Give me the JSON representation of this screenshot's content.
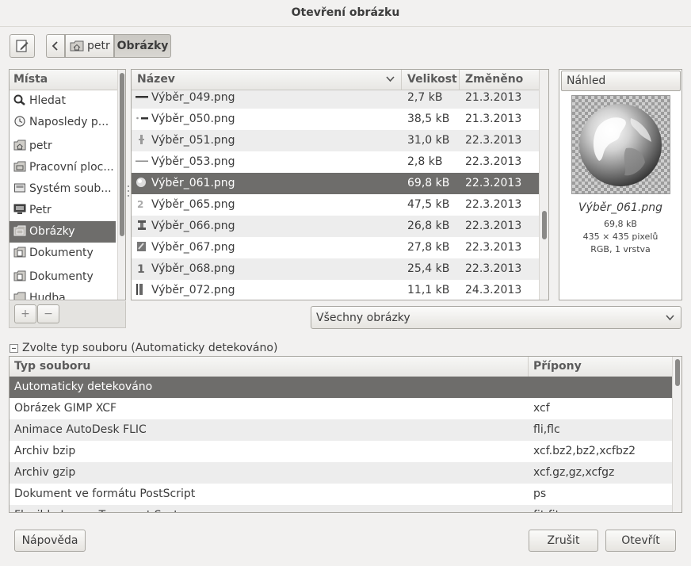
{
  "window": {
    "title": "Otevření obrázku"
  },
  "toolbar": {
    "edit_icon": "pencil-icon",
    "back_icon": "chevron-left-icon",
    "path": [
      {
        "label": "petr",
        "icon": "home-folder-icon"
      },
      {
        "label": "Obrázky"
      }
    ]
  },
  "places": {
    "header": "Místa",
    "items": [
      {
        "label": "Hledat",
        "icon": "search-icon"
      },
      {
        "label": "Naposledy p...",
        "icon": "clock-icon"
      },
      {
        "label": "petr",
        "icon": "home-folder-icon"
      },
      {
        "label": "Pracovní ploc...",
        "icon": "folder-icon"
      },
      {
        "label": "Systém soub...",
        "icon": "drive-icon"
      },
      {
        "label": "Petr",
        "icon": "computer-icon"
      },
      {
        "label": "Obrázky",
        "icon": "folder-icon",
        "selected": true
      },
      {
        "label": "Dokumenty",
        "icon": "folder-icon"
      },
      {
        "label": "Dokumenty",
        "icon": "folder-icon"
      },
      {
        "label": "Hudba",
        "icon": "folder-icon"
      }
    ],
    "add_label": "+",
    "remove_label": "−"
  },
  "files": {
    "columns": {
      "name": "Název",
      "size": "Velikost",
      "modified": "Změněno"
    },
    "rows": [
      {
        "name": "Výběr_049.png",
        "size": "2,7 kB",
        "modified": "21.3.2013"
      },
      {
        "name": "Výběr_050.png",
        "size": "38,5 kB",
        "modified": "21.3.2013"
      },
      {
        "name": "Výběr_051.png",
        "size": "31,0 kB",
        "modified": "22.3.2013"
      },
      {
        "name": "Výběr_053.png",
        "size": "2,8 kB",
        "modified": "22.3.2013"
      },
      {
        "name": "Výběr_061.png",
        "size": "69,8 kB",
        "modified": "22.3.2013",
        "selected": true
      },
      {
        "name": "Výběr_065.png",
        "size": "47,5 kB",
        "modified": "22.3.2013"
      },
      {
        "name": "Výběr_066.png",
        "size": "26,8 kB",
        "modified": "22.3.2013"
      },
      {
        "name": "Výběr_067.png",
        "size": "27,8 kB",
        "modified": "22.3.2013"
      },
      {
        "name": "Výběr_068.png",
        "size": "25,4 kB",
        "modified": "22.3.2013"
      },
      {
        "name": "Výběr_072.png",
        "size": "11,1 kB",
        "modified": "24.3.2013"
      }
    ]
  },
  "preview": {
    "header": "Náhled",
    "filename": "Výběr_061.png",
    "size": "69,8 kB",
    "dimensions": "435 × 435 pixelů",
    "mode": "RGB, 1 vrstva"
  },
  "filter": {
    "selected": "Všechny obrázky"
  },
  "filetype": {
    "expander_label": "Zvolte typ souboru (Automaticky detekováno)",
    "columns": {
      "type": "Typ souboru",
      "ext": "Přípony"
    },
    "rows": [
      {
        "type": "Automaticky detekováno",
        "ext": "",
        "selected": true
      },
      {
        "type": "Obrázek GIMP XCF",
        "ext": "xcf"
      },
      {
        "type": "Animace AutoDesk FLIC",
        "ext": "fli,flc"
      },
      {
        "type": "Archiv bzip",
        "ext": "xcf.bz2,bz2,xcfbz2"
      },
      {
        "type": "Archiv gzip",
        "ext": "xcf.gz,gz,xcfgz"
      },
      {
        "type": "Dokument ve formátu PostScript",
        "ext": "ps"
      },
      {
        "type": "Flexible Image Transport System",
        "ext": "fit,fits"
      }
    ]
  },
  "buttons": {
    "help": "Nápověda",
    "cancel": "Zrušit",
    "open": "Otevřít"
  }
}
